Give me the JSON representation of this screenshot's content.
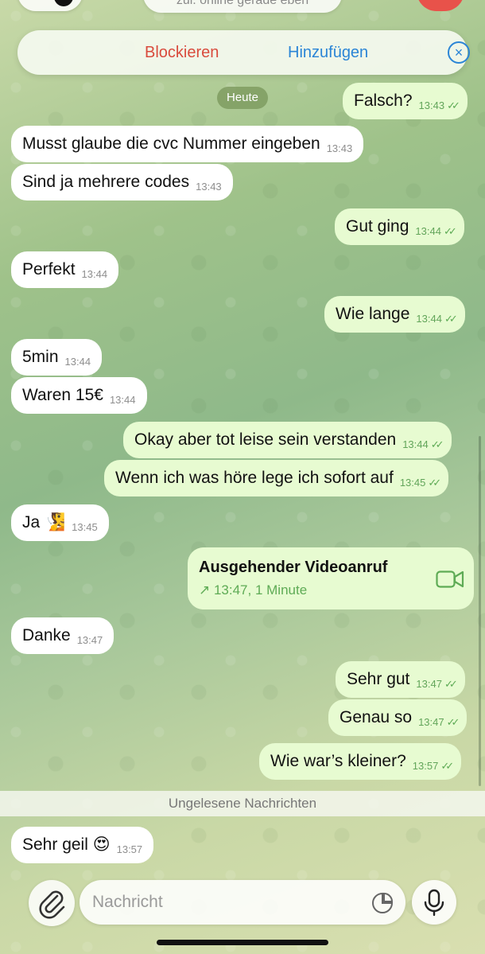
{
  "header": {
    "status": "zul. online gerade eben"
  },
  "action_bar": {
    "block_label": "Blockieren",
    "add_label": "Hinzufügen"
  },
  "date_chip": "Heute",
  "messages": [
    {
      "dir": "out",
      "text": "Falsch?",
      "time": "13:43",
      "read": true
    },
    {
      "dir": "in",
      "text": "Musst glaube die cvc Nummer eingeben",
      "time": "13:43"
    },
    {
      "dir": "in",
      "text": "Sind ja mehrere codes",
      "time": "13:43"
    },
    {
      "dir": "out",
      "text": "Gut ging",
      "time": "13:44",
      "read": true
    },
    {
      "dir": "in",
      "text": "Perfekt",
      "time": "13:44"
    },
    {
      "dir": "out",
      "text": "Wie lange",
      "time": "13:44",
      "read": true
    },
    {
      "dir": "in",
      "text": "5min",
      "time": "13:44"
    },
    {
      "dir": "in",
      "text": "Waren 15€",
      "time": "13:44"
    },
    {
      "dir": "out",
      "text": "Okay aber tot leise sein verstanden",
      "time": "13:44",
      "read": true
    },
    {
      "dir": "out",
      "text": "Wenn ich was höre lege ich sofort auf",
      "time": "13:45",
      "read": true
    },
    {
      "dir": "in",
      "text": "Ja 🧏",
      "time": "13:45"
    },
    {
      "dir": "in",
      "text": "Danke",
      "time": "13:47"
    },
    {
      "dir": "out",
      "text": "Sehr gut",
      "time": "13:47",
      "read": true
    },
    {
      "dir": "out",
      "text": "Genau so",
      "time": "13:47",
      "read": true
    },
    {
      "dir": "out",
      "text": "Wie war’s kleiner?",
      "time": "13:57",
      "read": true
    },
    {
      "dir": "in",
      "text": "Sehr geil 😍",
      "time": "13:57"
    }
  ],
  "call": {
    "title": "Ausgehender Videoanruf",
    "subtitle": "↗ 13:47, 1 Minute"
  },
  "unread_label": "Ungelesene Nachrichten",
  "composer": {
    "placeholder": "Nachricht"
  },
  "icons": {
    "close": "close-circle-icon",
    "camera": "video-camera-icon",
    "attach": "paperclip-icon",
    "sticker": "sticker-icon",
    "mic": "microphone-icon",
    "read": "double-check-icon"
  },
  "colors": {
    "outgoing_bubble": "#e7fbd1",
    "incoming_bubble": "#ffffff",
    "block": "#d94b3d",
    "add": "#2b85d6",
    "check": "#5eab55"
  }
}
